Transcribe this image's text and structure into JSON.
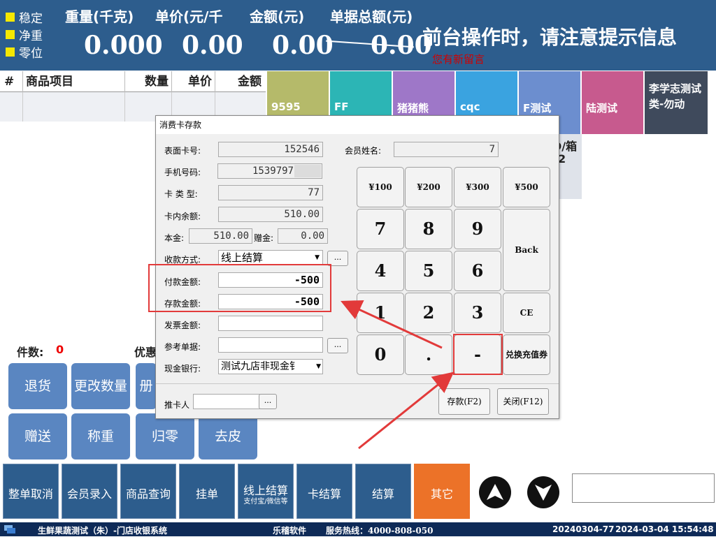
{
  "topbar": {
    "status": [
      "稳定",
      "净重",
      "零位"
    ],
    "headers": {
      "weight": "重量(千克)",
      "unit_price": "单价(元/千",
      "amount": "金额(元)",
      "total": "单据总额(元)"
    },
    "values": {
      "weight": "0.000",
      "unit_price": "0.00",
      "amount": "0.00",
      "total": "0.00"
    },
    "notice": "前台操作时，请注意提示信息",
    "new_message": "您有新留言"
  },
  "table": {
    "columns": [
      "#",
      "商品项目",
      "数量",
      "单价",
      "金额"
    ]
  },
  "categories": [
    {
      "label": "9595",
      "color": "#b5ba6a"
    },
    {
      "label": "FF",
      "color": "#2cb5b5"
    },
    {
      "label": "猪猪熊",
      "color": "#9e77c8"
    },
    {
      "label": "cqc",
      "color": "#3aa3e0"
    },
    {
      "label": "F测试",
      "color": "#6c8ecf"
    },
    {
      "label": "陆测试",
      "color": "#c75a8e"
    },
    {
      "label": "李学志测试类-勿动",
      "color": "#3f4a5c"
    }
  ],
  "partial_item": {
    "line1": "D/箱",
    "line2": "2"
  },
  "counts": {
    "items_label": "件数:",
    "items_value": "0",
    "discount_label": "优惠"
  },
  "func_buttons": [
    "退货",
    "更改数量",
    "册",
    "赠送",
    "称重",
    "归零",
    "去皮"
  ],
  "bottom_buttons": [
    "整单取消",
    "会员录入",
    "商品查询",
    "挂单",
    "线上结算",
    "卡结算",
    "结算",
    "其它"
  ],
  "online_sub": "支付宝/微信等",
  "footer": {
    "system": "生鲜果蔬测试（朱）-门店收银系统",
    "company": "乐稽软件",
    "hotline": "服务热线：4000-808-050",
    "doc": "20240304-77",
    "datetime": "2024-03-04 15:54:48"
  },
  "dialog": {
    "title": "消费卡存款",
    "fields": {
      "card_no_label": "表面卡号:",
      "card_no": "152546",
      "member_name_label": "会员姓名:",
      "member_name": "7",
      "phone_label": "手机号码:",
      "phone": "1539797",
      "card_type_label": "卡 类 型:",
      "card_type": "77",
      "balance_label": "卡内余额:",
      "balance": "510.00",
      "principal_label": "本金:",
      "principal": "510.00",
      "gift_label": "赠金:",
      "gift": "0.00",
      "pay_method_label": "收款方式:",
      "pay_method": "线上结算",
      "pay_amount_label": "付款金额:",
      "pay_amount": "-500",
      "deposit_amount_label": "存款金额:",
      "deposit_amount": "-500",
      "invoice_label": "发票金额:",
      "invoice": "",
      "ref_label": "参考单据:",
      "ref": "",
      "cash_bank_label": "现金银行:",
      "cash_bank": "测试九店非现金钅",
      "pusher_label": "推卡人",
      "pusher": ""
    },
    "ellipsis": "...",
    "keys": {
      "y100": "¥100",
      "y200": "¥200",
      "y300": "¥300",
      "y500": "¥500",
      "k7": "7",
      "k8": "8",
      "k9": "9",
      "back": "Back",
      "k4": "4",
      "k5": "5",
      "k6": "6",
      "k1": "1",
      "k2": "2",
      "k3": "3",
      "ce": "CE",
      "k0": "0",
      "dot": ".",
      "minus": "-",
      "voucher": "兑换充值券"
    },
    "deposit_btn": "存款(F2)",
    "close_btn": "关闭(F12)"
  }
}
